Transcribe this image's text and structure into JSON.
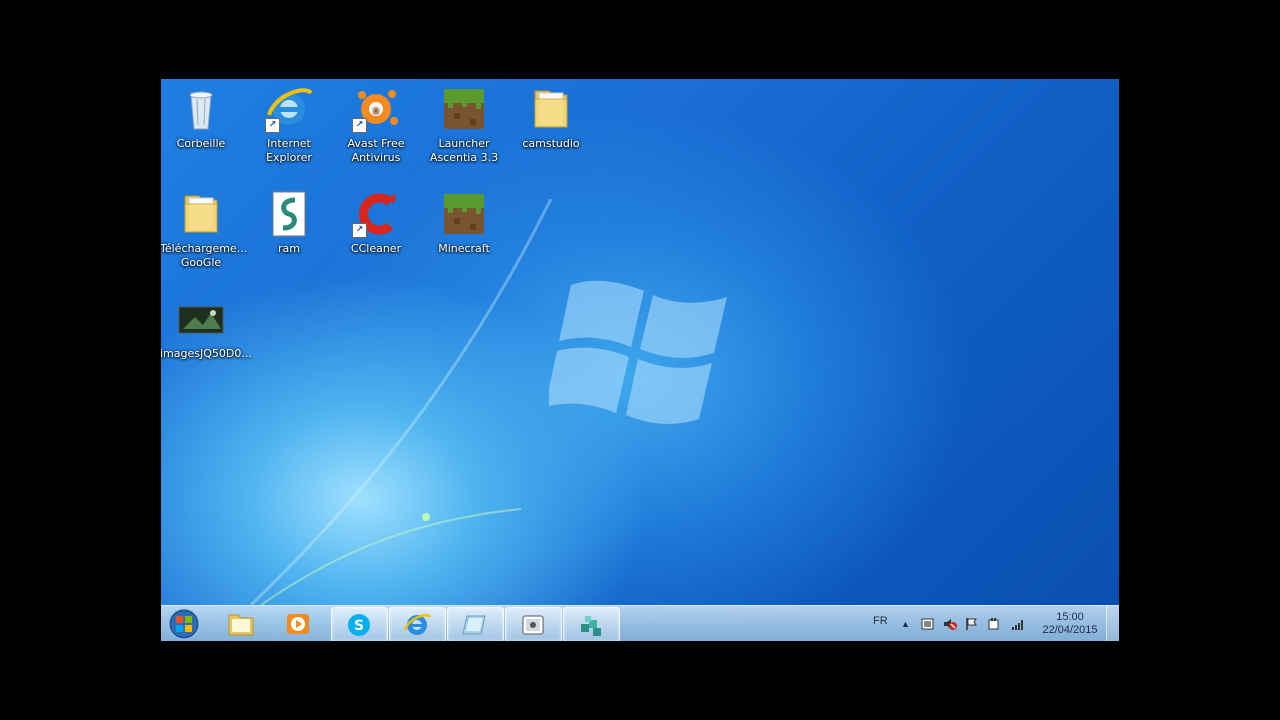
{
  "desktop": {
    "icons": [
      {
        "label": "Corbeille",
        "icon": "recycle-bin-icon"
      },
      {
        "label": "Internet Explorer",
        "icon": "internet-explorer-icon"
      },
      {
        "label": "Avast Free Antivirus",
        "icon": "avast-icon"
      },
      {
        "label": "Launcher Ascentia 3.3",
        "icon": "minecraft-block-icon"
      },
      {
        "label": "camstudio",
        "icon": "folder-icon"
      },
      {
        "label": "Téléchargeme... GooGle",
        "icon": "folder-icon"
      },
      {
        "label": "ram",
        "icon": "script-file-icon"
      },
      {
        "label": "CCleaner",
        "icon": "ccleaner-icon"
      },
      {
        "label": "Minecraft",
        "icon": "minecraft-block-icon"
      },
      {
        "label": "imagesJQ50D0...",
        "icon": "image-file-icon"
      }
    ]
  },
  "taskbar": {
    "buttons": [
      {
        "name": "start-button",
        "icon": "windows-orb-icon"
      },
      {
        "name": "explorer",
        "icon": "folder-icon"
      },
      {
        "name": "media-player",
        "icon": "media-player-icon"
      },
      {
        "name": "skype",
        "icon": "skype-icon"
      },
      {
        "name": "internet-explorer",
        "icon": "internet-explorer-icon"
      },
      {
        "name": "app",
        "icon": "app-window-icon"
      },
      {
        "name": "camstudio",
        "icon": "camera-icon"
      },
      {
        "name": "app2",
        "icon": "puzzle-icon"
      }
    ],
    "tray": {
      "language": "FR",
      "time": "15:00",
      "date": "22/04/2015"
    }
  },
  "colors": {
    "desktop": "#1a6fd4",
    "taskbar": "#b0cfe9"
  }
}
